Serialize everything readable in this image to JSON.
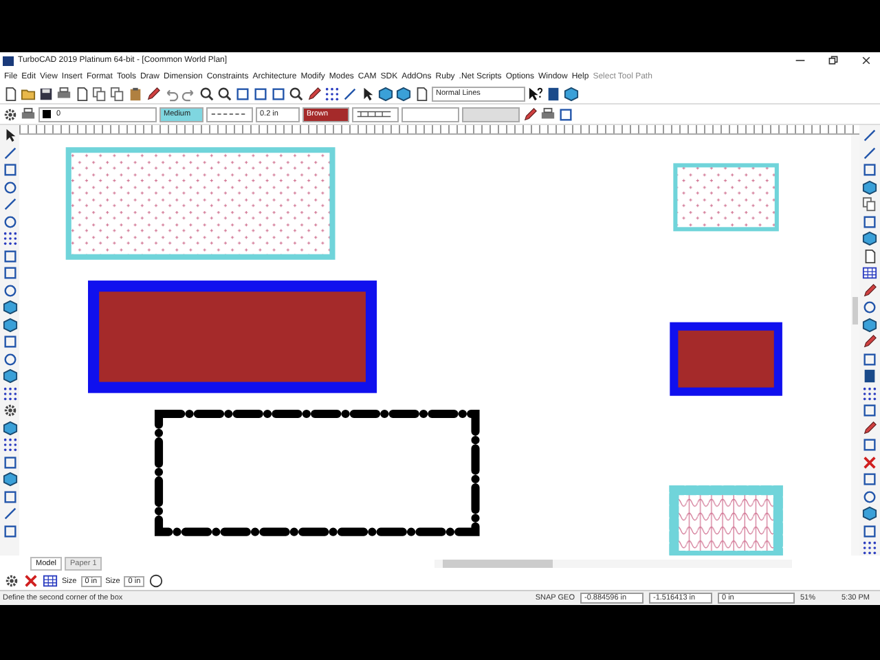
{
  "window": {
    "title": "TurboCAD 2019 Platinum 64-bit - [Coommon World Plan]"
  },
  "menu": [
    {
      "label": "File",
      "disabled": false
    },
    {
      "label": "Edit",
      "disabled": false
    },
    {
      "label": "View",
      "disabled": false
    },
    {
      "label": "Insert",
      "disabled": false
    },
    {
      "label": "Format",
      "disabled": false
    },
    {
      "label": "Tools",
      "disabled": false
    },
    {
      "label": "Draw",
      "disabled": false
    },
    {
      "label": "Dimension",
      "disabled": false
    },
    {
      "label": "Constraints",
      "disabled": false
    },
    {
      "label": "Architecture",
      "disabled": false
    },
    {
      "label": "Modify",
      "disabled": false
    },
    {
      "label": "Modes",
      "disabled": false
    },
    {
      "label": "CAM",
      "disabled": false
    },
    {
      "label": "SDK",
      "disabled": false
    },
    {
      "label": "AddOns",
      "disabled": false
    },
    {
      "label": "Ruby",
      "disabled": false
    },
    {
      "label": ".Net Scripts",
      "disabled": false
    },
    {
      "label": "Options",
      "disabled": false
    },
    {
      "label": "Window",
      "disabled": false
    },
    {
      "label": "Help",
      "disabled": false
    },
    {
      "label": "Select Tool Path",
      "disabled": true
    }
  ],
  "toolbar": {
    "line_style": "Normal Lines"
  },
  "properties_bar": {
    "layer": "0",
    "pen_width": "Medium",
    "line_width": "0.2 in",
    "pen_color": "Brown"
  },
  "tabs": [
    {
      "label": "Model",
      "selected": true
    },
    {
      "label": "Paper 1",
      "selected": false
    }
  ],
  "size_fields": [
    {
      "label": "Size",
      "value": "0 in"
    },
    {
      "label": "Size",
      "value": "0 in"
    }
  ],
  "status_bar": {
    "prompt": "Define the second corner of the box",
    "snap": "SNAP GEO",
    "x": "-0.884596 in",
    "y": "-1.516413 in",
    "z": "0 in",
    "zoom": "51%",
    "time": "5:30 PM"
  }
}
